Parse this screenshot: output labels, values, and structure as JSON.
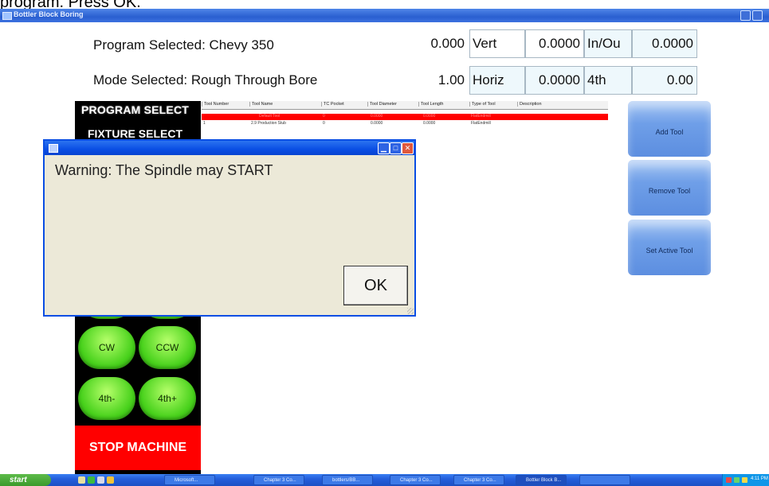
{
  "caption": "program. Press OK.",
  "window": {
    "title": "Bottler Block Boring"
  },
  "info": {
    "program_label": "Program Selected: Chevy 350",
    "mode_label": "Mode Selected: Rough Through Bore",
    "val1": "0.000",
    "vert_label": "Vert",
    "vert_value": "0.0000",
    "inout_label": "In/Ou",
    "inout_value": "0.0000",
    "val2": "1.00",
    "horiz_label": "Horiz",
    "horiz_value": "0.0000",
    "fourth_label": "4th",
    "fourth_value": "0.00"
  },
  "left_panel": {
    "program_select": "PROGRAM SELECT",
    "fixture_select": "FIXTURE SELECT",
    "cw": "CW",
    "ccw": "CCW",
    "fourth_minus": "4th-",
    "fourth_plus": "4th+",
    "stop_machine": "STOP MACHINE"
  },
  "tool_table": {
    "columns": [
      "Tool Number",
      "Tool Name",
      "TC Pocket",
      "Tool Diameter",
      "Tool Length",
      "Type of Tool",
      "Description"
    ],
    "rows": [
      [
        "",
        "Default Tool",
        "0",
        "0.0000",
        "0.0000",
        "FlatEndmill",
        ""
      ],
      [
        "1",
        "2.9 Production Stub",
        "0",
        "0.0000",
        "0.0000",
        "FlatEndmill",
        ""
      ]
    ],
    "selected_row_color": "#ff0000"
  },
  "right_buttons": {
    "add_tool": "Add Tool",
    "remove_tool": "Remove Tool",
    "set_active_tool": "Set Active Tool"
  },
  "dialog": {
    "message": "Warning: The Spindle may START",
    "ok_label": "OK"
  },
  "taskbar": {
    "start": "start",
    "tasks": [
      "Microsoft...",
      "Chapter 3 Co...",
      "bottlers/BB...",
      "Chapter 3 Co...",
      "Chapter 3 Co...",
      "Bottler Block B...",
      ""
    ],
    "clock": "4:11 PM"
  },
  "colors": {
    "green_button": "#47d11b",
    "stop_red": "#ff0000",
    "blue_button": "#6f9fe8",
    "xp_blue": "#0a4ee4"
  }
}
